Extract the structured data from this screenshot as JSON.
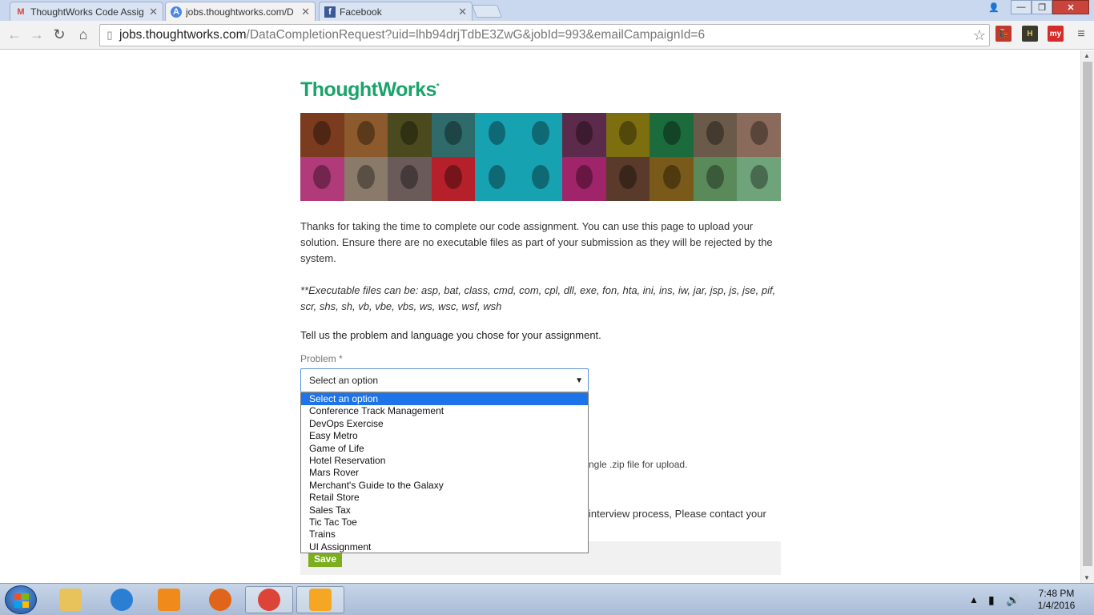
{
  "tabs": [
    {
      "title": "ThoughtWorks Code Assig",
      "icon": "gmail-icon",
      "color": "#d44638"
    },
    {
      "title": "jobs.thoughtworks.com/D",
      "icon": "site-icon",
      "color": "#4a86e8"
    },
    {
      "title": "Facebook",
      "icon": "facebook-icon",
      "color": "#3b5998"
    }
  ],
  "address_bar": {
    "host": "jobs.thoughtworks.com",
    "path": "/DataCompletionRequest?uid=lhb94drjTdbE3ZwG&jobId=993&emailCampaignId=6"
  },
  "page": {
    "logo": "ThoughtWorks",
    "logo_mark": "*",
    "intro": "Thanks for taking the time to complete our code assignment. You can use this page to upload your solution. Ensure there are no executable files as part of your submission as they will be rejected by the system.",
    "exec_note": "**Executable files can be: asp, bat, class, cmd, com, cpl, dll, exe, fon, hta, ini, ins, iw, jar, jsp, js, jse, pif, scr, shs, sh, vb, vbe, vbs, ws, wsc, wsf, wsh",
    "tell_us": "Tell us the problem and language you chose for your assignment.",
    "problem_label": "Problem *",
    "problem_value": "Select an option",
    "behind_zip": "ngle .zip file for upload.",
    "behind_contact": "interview process, Please contact your",
    "save": "Save"
  },
  "dropdown": {
    "options": [
      "Select an option",
      "Conference Track Management",
      "DevOps Exercise",
      "Easy Metro",
      "Game of Life",
      "Hotel Reservation",
      "Mars Rover",
      "Merchant's Guide to the Galaxy",
      "Retail Store",
      "Sales Tax",
      "Tic Tac Toe",
      "Trains",
      "UI Assignment"
    ],
    "selected_index": 0
  },
  "banner_colors": [
    "#7a3b1f",
    "#8c5a2c",
    "#4a4a1e",
    "#2f6b6b",
    "#17a2b2",
    "#17a2b2",
    "#5c2a4a",
    "#7d6f10",
    "#1c6b3c",
    "#6b5a4a",
    "#8a6a5a",
    "#b03a7a",
    "#8a7a6a",
    "#6a5a5a",
    "#b5202a",
    "#17a2b2",
    "#17a2b2",
    "#a0246a",
    "#5a3a2a",
    "#7a5a1a",
    "#5a8a5a",
    "#6fa37a"
  ],
  "taskbar": {
    "time": "7:48 PM",
    "date": "1/4/2016",
    "apps": [
      {
        "name": "explorer-icon",
        "color": "#e8c25a"
      },
      {
        "name": "ie-icon",
        "color": "#2a7fd4"
      },
      {
        "name": "media-player-icon",
        "color": "#f08a1a"
      },
      {
        "name": "firefox-icon",
        "color": "#e0651a"
      },
      {
        "name": "chrome-icon",
        "color": "#db4437"
      },
      {
        "name": "audacity-icon",
        "color": "#f5a623"
      }
    ]
  },
  "extensions": [
    {
      "name": "train-extension-icon",
      "label": "🚂",
      "color": "#c0392b"
    },
    {
      "name": "h-extension-icon",
      "label": "H",
      "color": "#3a3a2a"
    },
    {
      "name": "my-extension-icon",
      "label": "my",
      "color": "#d62b2b"
    }
  ]
}
